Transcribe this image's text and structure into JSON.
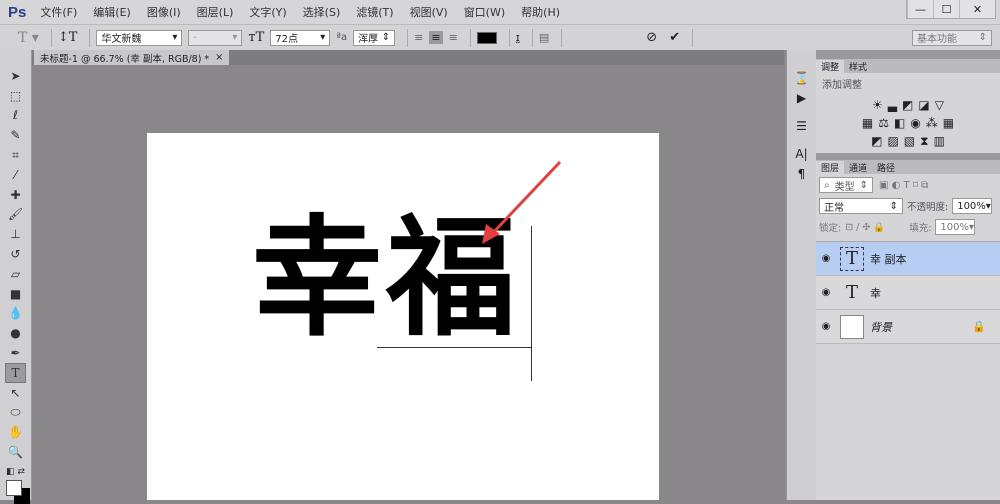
{
  "app": {
    "logo": "Ps",
    "menu": [
      "文件(F)",
      "编辑(E)",
      "图像(I)",
      "图层(L)",
      "文字(Y)",
      "选择(S)",
      "滤镜(T)",
      "视图(V)",
      "窗口(W)",
      "帮助(H)"
    ]
  },
  "window": {
    "minimize": "—",
    "maximize": "☐",
    "close": "✕"
  },
  "options": {
    "font_family": "华文新魏",
    "font_style": "-",
    "font_size": "72点",
    "antialias": "浑厚",
    "workspace": "基本功能",
    "color": "#000000"
  },
  "document": {
    "tab_title": "未标题-1 @ 66.7% (幸 副本, RGB/8) *",
    "close": "×",
    "canvas_text": "幸福"
  },
  "adjust_panel": {
    "tabs": [
      "调整",
      "样式"
    ],
    "title": "添加调整"
  },
  "layers_panel": {
    "tabs": [
      "图层",
      "通道",
      "路径"
    ],
    "filter": "类型",
    "blend_mode": "正常",
    "opacity_label": "不透明度:",
    "opacity": "100%",
    "lock_label": "锁定:",
    "fill_label": "填充:",
    "fill": "100%",
    "layers": [
      {
        "name": "幸 副本",
        "type": "text",
        "selected": true
      },
      {
        "name": "幸",
        "type": "text",
        "selected": false
      },
      {
        "name": "背景",
        "type": "background",
        "locked": true
      }
    ]
  },
  "annotation_color": "#e04040"
}
